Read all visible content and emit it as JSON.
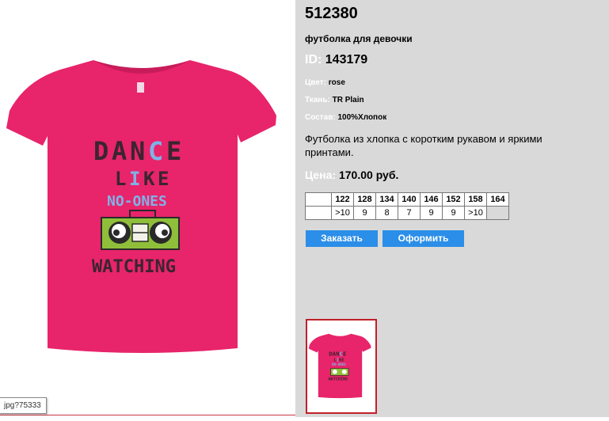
{
  "product": {
    "article": "512380",
    "subtitle": "футболка для девочки",
    "id_label": "ID:",
    "id_value": "143179",
    "color_label": "Цвет:",
    "color_value": "rose",
    "fabric_label": "Ткань:",
    "fabric_value": "TR Plain",
    "composition_label": "Состав:",
    "composition_value": "100%Хлопок",
    "description": "Футболка из хлопка с коротким рукавом и яркими принтами.",
    "price_label": "Цена:",
    "price_value": "170.00 руб."
  },
  "sizes": {
    "headers": [
      "",
      "122",
      "128",
      "134",
      "140",
      "146",
      "152",
      "158",
      "164"
    ],
    "stock": [
      "",
      ">10",
      "9",
      "8",
      "7",
      "9",
      "9",
      ">10",
      ""
    ]
  },
  "buttons": {
    "order": "Заказать",
    "checkout": "Оформить"
  },
  "shirt_print": {
    "line1": [
      "D",
      "A",
      "N",
      "C",
      "E"
    ],
    "line2": [
      "L",
      "I",
      "K",
      "E"
    ],
    "line3": "NO-ONES",
    "line4": "WATCHING"
  },
  "tooltip": "jpg?75333",
  "colors": {
    "shirt": "#e8246a",
    "panel": "#d9d9d9",
    "button": "#2b8ee8",
    "thumb_border": "#c0202a",
    "print_dark": "#3a2530",
    "print_blue": "#7fb2e8",
    "boombox": "#8fbf3a"
  }
}
